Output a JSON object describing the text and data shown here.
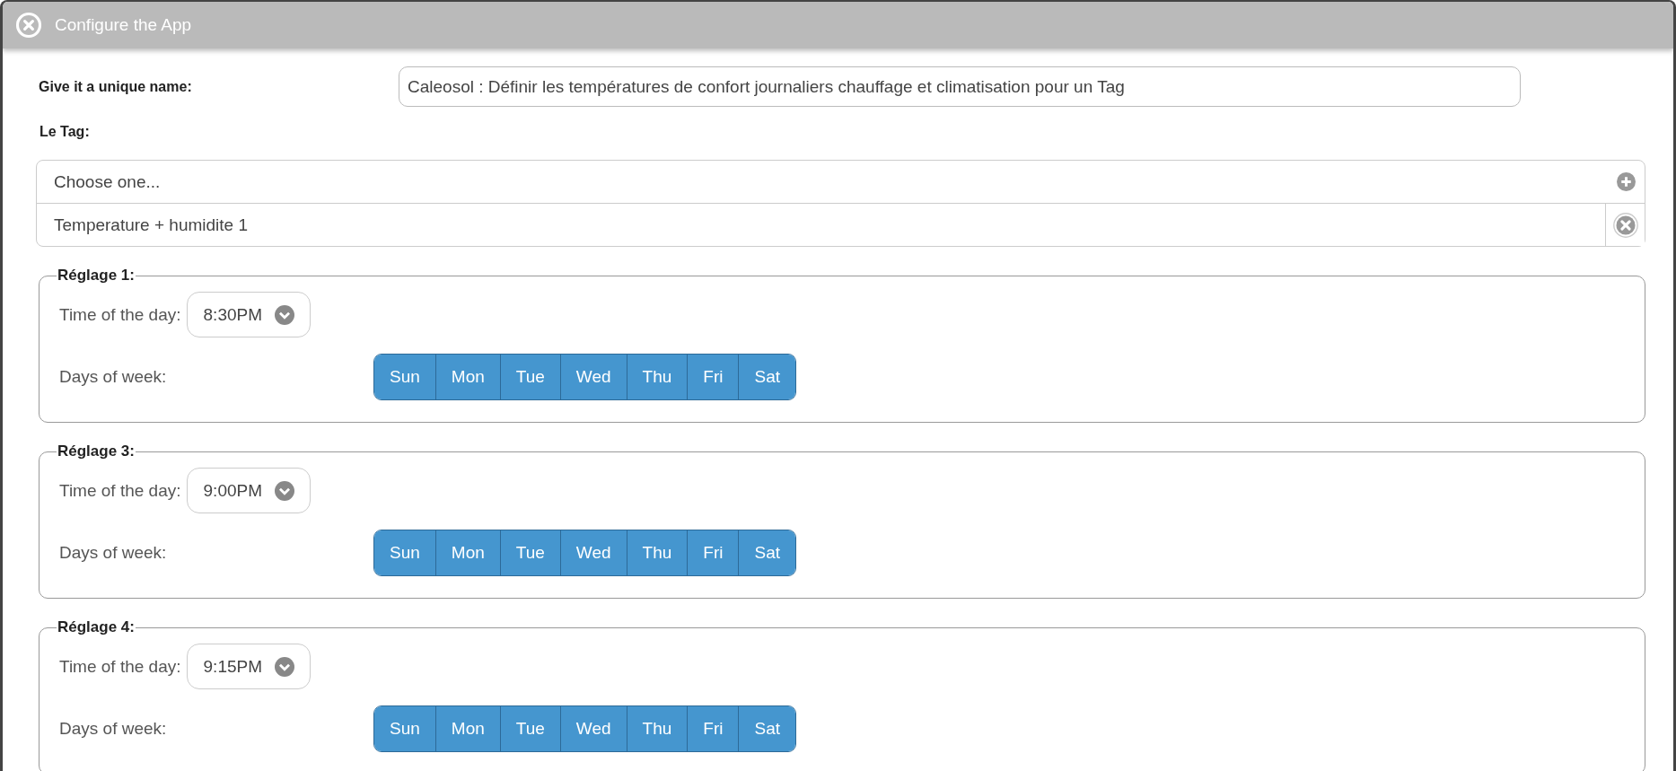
{
  "window": {
    "title": "Configure the App"
  },
  "name_field": {
    "label": "Give it a unique name:",
    "value": "Caleosol : Définir les températures de confort journaliers chauffage et climatisation pour un Tag"
  },
  "tag": {
    "label": "Le Tag:",
    "placeholder": "Choose one...",
    "items": [
      "Temperature + humidite 1"
    ]
  },
  "settings": [
    {
      "legend": "Réglage 1:",
      "time_label": "Time of the day:",
      "time": "8:30PM",
      "days_label": "Days of week:",
      "days": [
        {
          "label": "Sun",
          "selected": true
        },
        {
          "label": "Mon",
          "selected": true
        },
        {
          "label": "Tue",
          "selected": true
        },
        {
          "label": "Wed",
          "selected": true
        },
        {
          "label": "Thu",
          "selected": true
        },
        {
          "label": "Fri",
          "selected": true
        },
        {
          "label": "Sat",
          "selected": true
        }
      ]
    },
    {
      "legend": "Réglage 3:",
      "time_label": "Time of the day:",
      "time": "9:00PM",
      "days_label": "Days of week:",
      "days": [
        {
          "label": "Sun",
          "selected": true
        },
        {
          "label": "Mon",
          "selected": true
        },
        {
          "label": "Tue",
          "selected": true
        },
        {
          "label": "Wed",
          "selected": true
        },
        {
          "label": "Thu",
          "selected": true
        },
        {
          "label": "Fri",
          "selected": true
        },
        {
          "label": "Sat",
          "selected": true
        }
      ]
    },
    {
      "legend": "Réglage 4:",
      "time_label": "Time of the day:",
      "time": "9:15PM",
      "days_label": "Days of week:",
      "days": [
        {
          "label": "Sun",
          "selected": true
        },
        {
          "label": "Mon",
          "selected": true
        },
        {
          "label": "Tue",
          "selected": true
        },
        {
          "label": "Wed",
          "selected": true
        },
        {
          "label": "Thu",
          "selected": true
        },
        {
          "label": "Fri",
          "selected": true
        },
        {
          "label": "Sat",
          "selected": true
        }
      ]
    }
  ]
}
